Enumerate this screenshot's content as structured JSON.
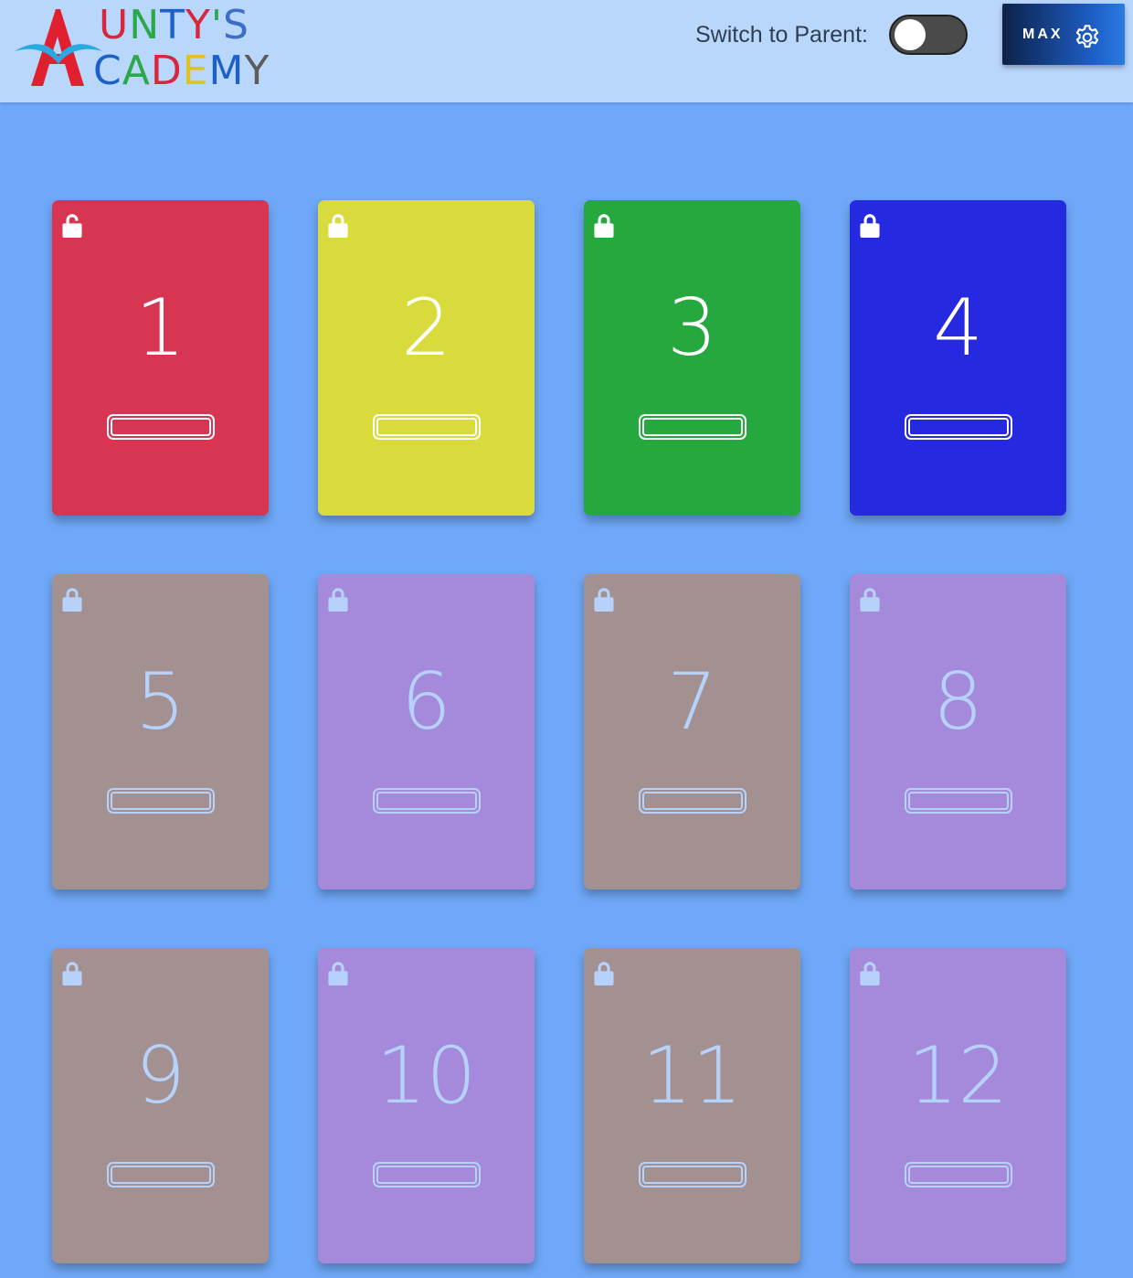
{
  "header": {
    "logo": {
      "word_top": "UNTY'S",
      "word_bottom": "CADEMY",
      "top_colors": [
        "#d7263d",
        "#2aa84a",
        "#1e5fc8",
        "#d7263d",
        "#2aa84a",
        "#3c6ec8"
      ],
      "bottom_colors": [
        "#1e5fc8",
        "#2aa84a",
        "#d7263d",
        "#e0c21e",
        "#1e5fc8",
        "#5c5c5c"
      ],
      "letter_colors": {
        "a_mark": "#e0202e",
        "book": "#2aa8e0"
      }
    },
    "switch_label": "Switch to Parent:",
    "toggle_on": false,
    "user_button": {
      "label": "MAX",
      "icon": "gear-icon"
    }
  },
  "levels": [
    {
      "number": "1",
      "locked": false,
      "color": "#d73552",
      "text_color": "#ffffff",
      "progress": 0
    },
    {
      "number": "2",
      "locked": true,
      "color": "#d9da3c",
      "text_color": "#ffffff",
      "progress": 0
    },
    {
      "number": "3",
      "locked": true,
      "color": "#25a93f",
      "text_color": "#ffffff",
      "progress": 0
    },
    {
      "number": "4",
      "locked": true,
      "color": "#2529e0",
      "text_color": "#ffffff",
      "progress": 0
    },
    {
      "number": "5",
      "locked": true,
      "color": "#a39090",
      "text_color": "#b7d2fa",
      "progress": 0
    },
    {
      "number": "6",
      "locked": true,
      "color": "#a58adc",
      "text_color": "#b7d2fa",
      "progress": 0
    },
    {
      "number": "7",
      "locked": true,
      "color": "#a39090",
      "text_color": "#b7d2fa",
      "progress": 0
    },
    {
      "number": "8",
      "locked": true,
      "color": "#a58adc",
      "text_color": "#b7d2fa",
      "progress": 0
    },
    {
      "number": "9",
      "locked": true,
      "color": "#a39090",
      "text_color": "#b7d2fa",
      "progress": 0
    },
    {
      "number": "10",
      "locked": true,
      "color": "#a58adc",
      "text_color": "#b7d2fa",
      "progress": 0
    },
    {
      "number": "11",
      "locked": true,
      "color": "#a39090",
      "text_color": "#b7d2fa",
      "progress": 0
    },
    {
      "number": "12",
      "locked": true,
      "color": "#a58adc",
      "text_color": "#b7d2fa",
      "progress": 0
    }
  ]
}
